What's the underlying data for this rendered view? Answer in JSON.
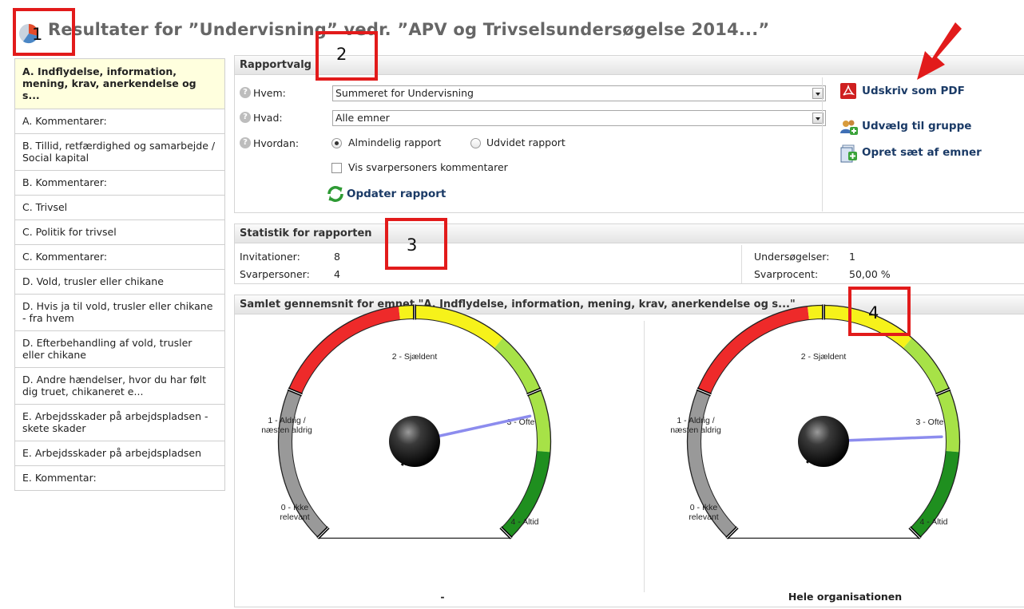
{
  "page": {
    "title": "Resultater for ”Undervisning” vedr. ”APV og Trivselsundersøgelse 2014...”"
  },
  "sidebar": {
    "items": [
      {
        "label": "A. Indflydelse, information, mening, krav, anerkendelse og s...",
        "active": true
      },
      {
        "label": "A. Kommentarer:"
      },
      {
        "label": "B. Tillid, retfærdighed og samarbejde / Social kapital"
      },
      {
        "label": "B. Kommentarer:"
      },
      {
        "label": "C. Trivsel"
      },
      {
        "label": "C. Politik for trivsel"
      },
      {
        "label": "C. Kommentarer:"
      },
      {
        "label": "D. Vold, trusler eller chikane"
      },
      {
        "label": "D. Hvis ja til vold, trusler eller chikane - fra hvem"
      },
      {
        "label": "D. Efterbehandling af vold, trusler eller chikane"
      },
      {
        "label": "D. Andre hændelser, hvor du har følt dig truet, chikaneret e..."
      },
      {
        "label": "E. Arbejdsskader på arbejdspladsen - skete skader"
      },
      {
        "label": "E. Arbejdsskader på arbejdspladsen"
      },
      {
        "label": "E. Kommentar:"
      }
    ]
  },
  "rapportvalg": {
    "header": "Rapportvalg",
    "hvem_label": "Hvem:",
    "hvem_value": "Summeret for Undervisning",
    "hvad_label": "Hvad:",
    "hvad_value": "Alle emner",
    "hvordan_label": "Hvordan:",
    "option_almindelig": "Almindelig rapport",
    "option_udvidet": "Udvidet rapport",
    "selected_option": "Almindelig rapport",
    "vis_kommentarer_label": "Vis svarpersoners kommentarer",
    "vis_kommentarer_checked": false,
    "update_label": "Opdater rapport",
    "help_symbol": "?"
  },
  "actions": {
    "pdf_label": "Udskriv som PDF",
    "group_label": "Udvælg til gruppe",
    "set_label": "Opret sæt af emner"
  },
  "statistik": {
    "header": "Statistik for rapporten",
    "invitationer_label": "Invitationer:",
    "invitationer_value": "8",
    "svarpersoner_label": "Svarpersoner:",
    "svarpersoner_value": "4",
    "undersogelser_label": "Undersøgelser:",
    "undersogelser_value": "1",
    "svarprocent_label": "Svarprocent:",
    "svarprocent_value": "50,00 %"
  },
  "samlet": {
    "header": "Samlet gennemsnit for emnet \"A. Indflydelse, information, mening, krav, anerkendelse og s...\"",
    "gauges": [
      {
        "caption": "-",
        "value": 3.15
      },
      {
        "caption": "Hele organisationen",
        "value": 3.3
      }
    ],
    "scale_labels": {
      "l0_line1": "0 - Ikke",
      "l0_line2": "relevant",
      "l1_line1": "1 - Aldrig /",
      "l1_line2": "næsten aldrig",
      "l2": "2 - Sjældent",
      "l3": "3 - Ofte",
      "l4": "4 - Altid"
    }
  },
  "markers": {
    "m1": "1",
    "m2": "2",
    "m3": "3",
    "m4": "4"
  },
  "colors": {
    "marker_red": "#e21b1b",
    "link_blue": "#1a3a66",
    "active_item_bg": "#ffffde",
    "gauge_red": "#ee2a2a",
    "gauge_yellow": "#f6f21a",
    "gauge_lightgreen": "#a7e247",
    "gauge_darkgreen": "#1f8f1f",
    "gauge_gray": "#999999",
    "needle": "#8c8cee"
  }
}
